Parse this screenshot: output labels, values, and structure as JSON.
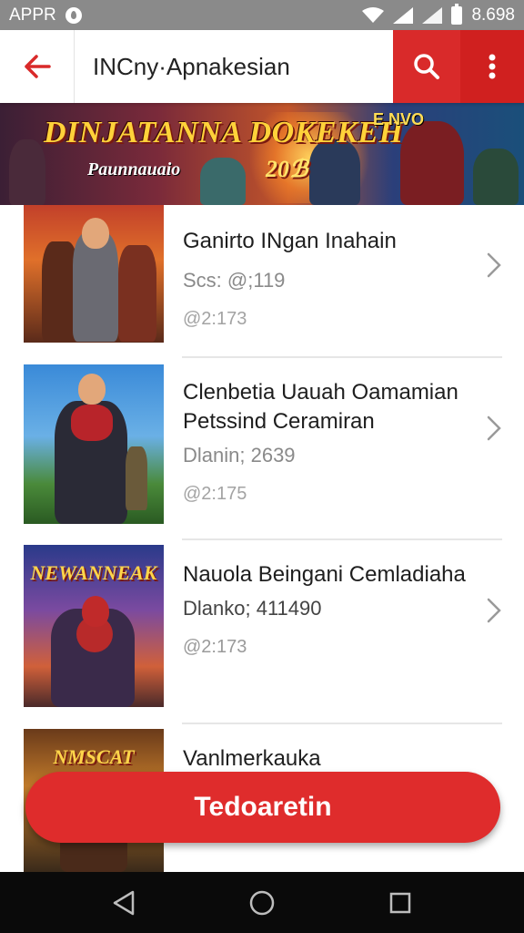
{
  "status_bar": {
    "carrier": "APPR",
    "time": "8.698",
    "icons": [
      "drop-icon",
      "wifi-icon",
      "signal-icon",
      "signal-icon",
      "battery-icon"
    ]
  },
  "toolbar": {
    "title": "INCny·Apnakesian",
    "icons": [
      "back-arrow-icon",
      "search-icon",
      "more-vert-icon"
    ],
    "accent": "#d92a2a"
  },
  "banner": {
    "title": "DINJATANNA DOKEKEH",
    "subtitle": "Paunnauaio",
    "year": "20ℬ",
    "tag": "E NVO"
  },
  "items": [
    {
      "title": "Ganirto INgan Inahain",
      "subtitle": "Scs: @;119",
      "meta": "@2:173",
      "thumb_text": ""
    },
    {
      "title": "Clenbetia Uauah Oamamian Petssind Ceramiran",
      "subtitle": "Dlanin; 2639",
      "meta": "@2:175",
      "thumb_text": ""
    },
    {
      "title": "Nauola Beingani Cemladiaha",
      "subtitle": "Dlanko; 411490",
      "meta": "@2:173",
      "thumb_text": "NEWANNEAK"
    },
    {
      "title": "Vanlmerkauka",
      "subtitle": "",
      "meta": "",
      "thumb_text": "NMSCAT"
    }
  ],
  "fab": {
    "label": "Tedoaretin"
  },
  "navbar": {
    "icons": [
      "back-triangle-icon",
      "home-circle-icon",
      "recents-square-icon"
    ]
  }
}
